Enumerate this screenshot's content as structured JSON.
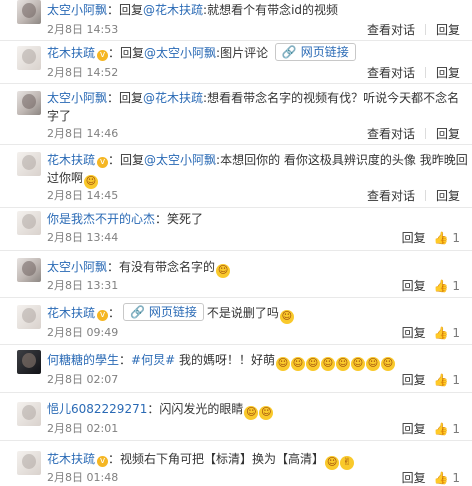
{
  "comments": [
    {
      "user": "太空小阿飘",
      "segments": [
        {
          "t": "：回复",
          "type": "text"
        },
        {
          "t": "@花木扶疏",
          "type": "name"
        },
        {
          "t": ":就想看个有带念id的视频",
          "type": "text"
        }
      ],
      "time": "2月8日 14:53",
      "actions": [
        "查看对话",
        "回复"
      ]
    },
    {
      "user": "花木扶疏",
      "segments": [
        {
          "t": "：回复",
          "type": "text"
        },
        {
          "t": "@太空小阿飘",
          "type": "name"
        },
        {
          "t": ":图片评论",
          "type": "text"
        },
        {
          "t": "网页链接",
          "type": "link"
        }
      ],
      "time": "2月8日 14:52",
      "actions": [
        "查看对话",
        "回复"
      ]
    },
    {
      "user": "太空小阿飘",
      "line1": [
        {
          "t": "：回复",
          "type": "text"
        },
        {
          "t": "@花木扶疏",
          "type": "name"
        },
        {
          "t": ":想看看带念名字的视频有伐？听说今天都不念名",
          "type": "text"
        }
      ],
      "line2": "字了",
      "time": "2月8日 14:46",
      "actions": [
        "查看对话",
        "回复"
      ]
    },
    {
      "user": "花木扶疏",
      "line1": [
        {
          "t": "：回复",
          "type": "text"
        },
        {
          "t": "@太空小阿飘",
          "type": "name"
        },
        {
          "t": ":本想回你的 看你这极具辨识度的头像 我昨晚回",
          "type": "text"
        }
      ],
      "line2": "过你啊",
      "time": "2月8日 14:45",
      "actions": [
        "查看对话",
        "回复"
      ]
    },
    {
      "user": "你是我杰不开的心杰",
      "text": "：笑死了",
      "time": "2月8日 13:44",
      "actions": [
        "回复"
      ],
      "likes": "1"
    },
    {
      "user": "太空小阿飘",
      "text": "：有没有带念名字的",
      "time": "2月8日 13:31",
      "actions": [
        "回复"
      ],
      "likes": "1"
    },
    {
      "user": "花木扶疏",
      "link": "网页链接",
      "text": "不是说删了吗",
      "time": "2月8日 09:49",
      "actions": [
        "回复"
      ],
      "likes": "1"
    },
    {
      "user": "何糖糖的學生",
      "tag": "#何炅#",
      "text": "我的媽呀！！好萌",
      "time": "2月8日 02:07",
      "actions": [
        "回复"
      ],
      "likes": "1"
    },
    {
      "user": "悒儿6082229271",
      "text": "：闪闪发光的眼睛",
      "time": "2月8日 02:01",
      "actions": [
        "回复"
      ],
      "likes": "1"
    },
    {
      "user": "花木扶疏",
      "text": "：视频右下角可把【标清】换为【高清】",
      "time": "2月8日 01:48",
      "actions": [
        "回复"
      ],
      "likes": "1"
    }
  ],
  "icons": {
    "verified": "v-badge-icon",
    "link": "link-icon",
    "like": "thumbs-up-icon",
    "emoji": "smiley-emoji-icon"
  },
  "colors": {
    "username": "#2a6ab5",
    "text": "#333333",
    "meta": "#808080",
    "badge": "#f5b623"
  }
}
